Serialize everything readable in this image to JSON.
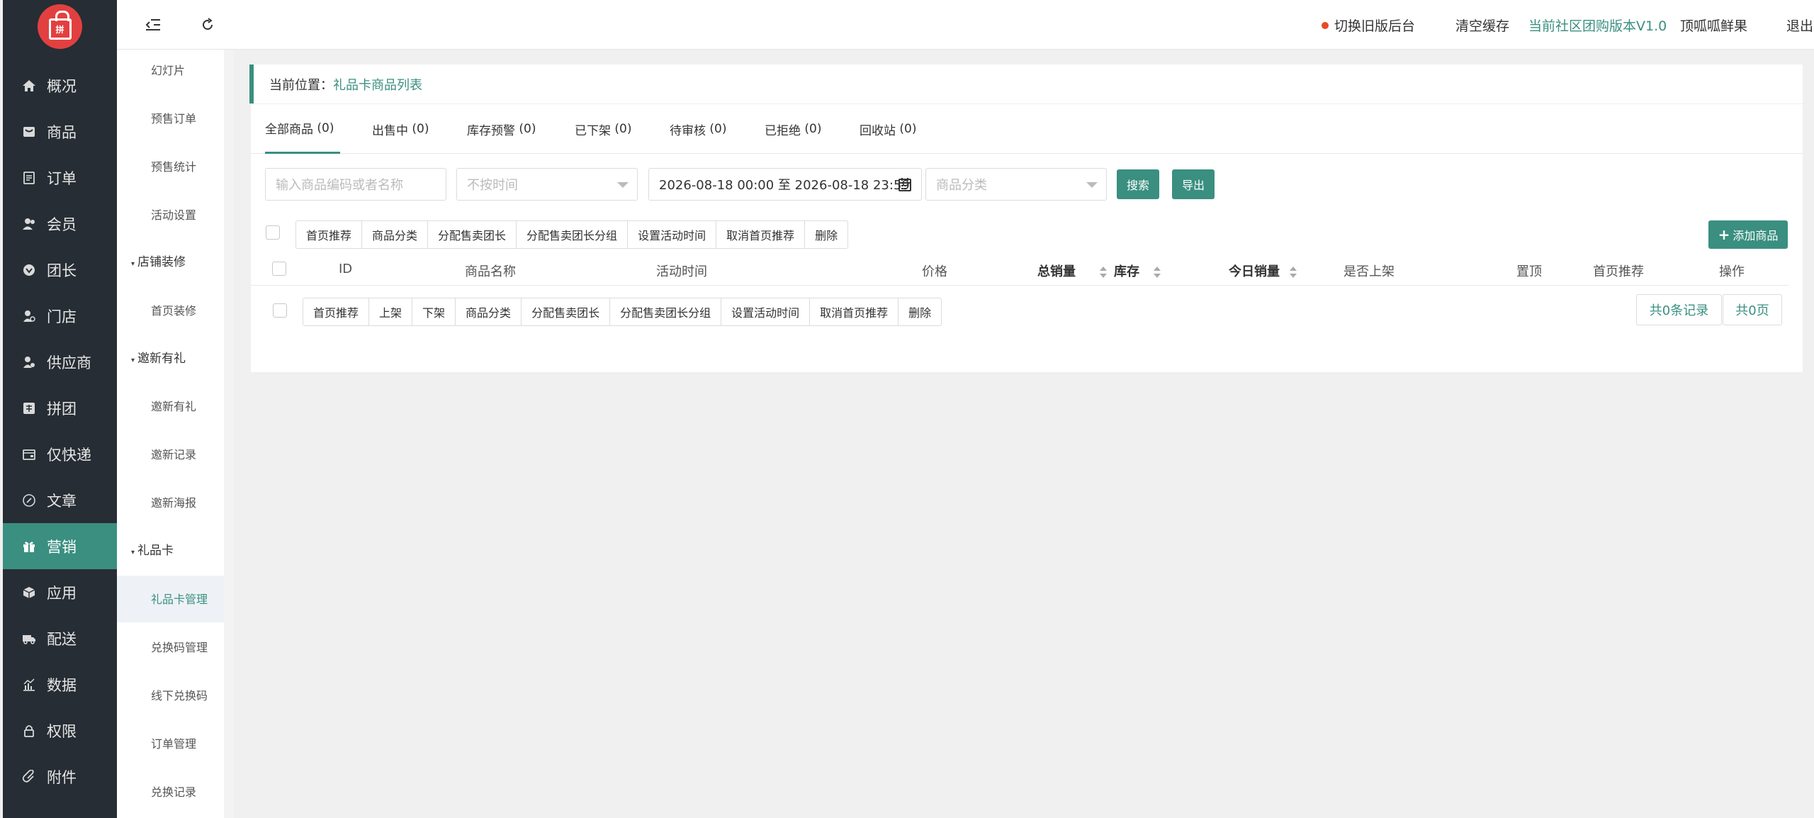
{
  "header": {
    "switch_old": "切换旧版后台",
    "clear_cache": "清空缓存",
    "version": "当前社区团购版本V1.0",
    "store_name": "顶呱呱鲜果",
    "logout": "退出"
  },
  "logo": {
    "glyph": "拼"
  },
  "nav": [
    {
      "label": "概况",
      "icon": "home-icon"
    },
    {
      "label": "商品",
      "icon": "goods-icon"
    },
    {
      "label": "订单",
      "icon": "order-icon"
    },
    {
      "label": "会员",
      "icon": "member-icon"
    },
    {
      "label": "团长",
      "icon": "leader-icon"
    },
    {
      "label": "门店",
      "icon": "store-icon"
    },
    {
      "label": "供应商",
      "icon": "supplier-icon"
    },
    {
      "label": "拼团",
      "icon": "group-buy-icon"
    },
    {
      "label": "仅快递",
      "icon": "express-icon"
    },
    {
      "label": "文章",
      "icon": "article-icon"
    },
    {
      "label": "营销",
      "icon": "gift-icon"
    },
    {
      "label": "应用",
      "icon": "app-icon"
    },
    {
      "label": "配送",
      "icon": "delivery-icon"
    },
    {
      "label": "数据",
      "icon": "data-icon"
    },
    {
      "label": "权限",
      "icon": "lock-icon"
    },
    {
      "label": "附件",
      "icon": "attachment-icon"
    }
  ],
  "subnav": {
    "items": [
      "幻灯片",
      "预售订单",
      "预售统计",
      "活动设置"
    ],
    "groups": {
      "shop_decor": "店铺装修",
      "shop_decor_items": [
        "首页装修"
      ],
      "invite": "邀新有礼",
      "invite_items": [
        "邀新有礼",
        "邀新记录",
        "邀新海报"
      ],
      "giftcard": "礼品卡",
      "giftcard_items": [
        "礼品卡管理",
        "兑换码管理",
        "线下兑换码",
        "订单管理",
        "兑换记录"
      ]
    }
  },
  "breadcrumb": {
    "prefix": "当前位置：",
    "current": "礼品卡商品列表"
  },
  "tabs": [
    {
      "label": "全部商品",
      "count": "(0)"
    },
    {
      "label": "出售中",
      "count": "(0)"
    },
    {
      "label": "库存预警",
      "count": "(0)"
    },
    {
      "label": "已下架",
      "count": "(0)"
    },
    {
      "label": "待审核",
      "count": "(0)"
    },
    {
      "label": "已拒绝",
      "count": "(0)"
    },
    {
      "label": "回收站",
      "count": "(0)"
    }
  ],
  "filters": {
    "keyword_placeholder": "输入商品编码或者名称",
    "time_placeholder": "不按时间",
    "date_range": "2026-08-18 00:00 至 2026-08-18 23:59",
    "category_placeholder": "商品分类",
    "search_label": "搜索",
    "export_label": "导出"
  },
  "batch_top": [
    "首页推荐",
    "商品分类",
    "分配售卖团长",
    "分配售卖团长分组",
    "设置活动时间",
    "取消首页推荐",
    "删除"
  ],
  "batch_bottom": [
    "首页推荐",
    "上架",
    "下架",
    "商品分类",
    "分配售卖团长",
    "分配售卖团长分组",
    "设置活动时间",
    "取消首页推荐",
    "删除"
  ],
  "add_goods": "添加商品",
  "columns": {
    "id": "ID",
    "name": "商品名称",
    "time": "活动时间",
    "price": "价格",
    "total_sales": "总销量",
    "stock": "库存",
    "today_sales": "今日销量",
    "on_shelf": "是否上架",
    "top": "置顶",
    "home_rec": "首页推荐",
    "actions": "操作"
  },
  "pagination": {
    "records": "共0条记录",
    "pages": "共0页"
  }
}
